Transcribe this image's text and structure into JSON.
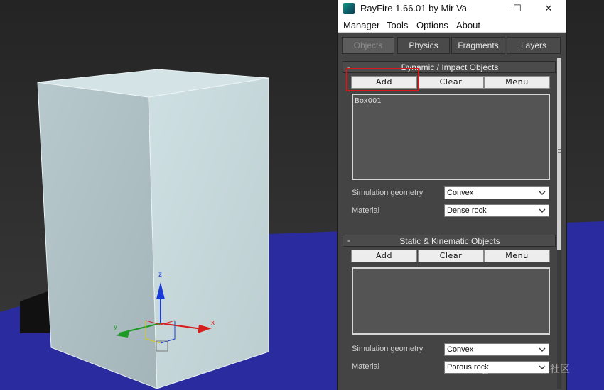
{
  "window": {
    "title": "RayFire 1.66.01  by Mir Va",
    "minimize": "—",
    "maximize": "☐",
    "close": "✕"
  },
  "menu": [
    "Manager",
    "Tools",
    "Options",
    "About"
  ],
  "tabs": [
    {
      "label": "Objects",
      "active": true
    },
    {
      "label": "Physics"
    },
    {
      "label": "Fragments"
    },
    {
      "label": "Layers"
    }
  ],
  "dynamic": {
    "title": "Dynamic / Impact Objects",
    "collapse": "-",
    "buttons": {
      "add": "Add",
      "clear": "Clear",
      "menu": "Menu"
    },
    "items": [
      "Box001"
    ],
    "sim_label": "Simulation geometry",
    "sim_value": "Convex",
    "mat_label": "Material",
    "mat_value": "Dense rock"
  },
  "static": {
    "title": "Static & Kinematic Objects",
    "collapse": "-",
    "buttons": {
      "add": "Add",
      "clear": "Clear",
      "menu": "Menu"
    },
    "sim_label": "Simulation geometry",
    "sim_value": "Convex",
    "mat_label": "Material",
    "mat_value": "Porous rock"
  },
  "viewport": {
    "axes": {
      "x": "x",
      "y": "y",
      "z": "z"
    },
    "colors": {
      "ground": "#2a2a9e",
      "box_front": "#aebfc4",
      "box_side": "#c4d6da",
      "box_top": "#cfe0e4"
    }
  },
  "watermark": "@稀土掘金技术社区"
}
